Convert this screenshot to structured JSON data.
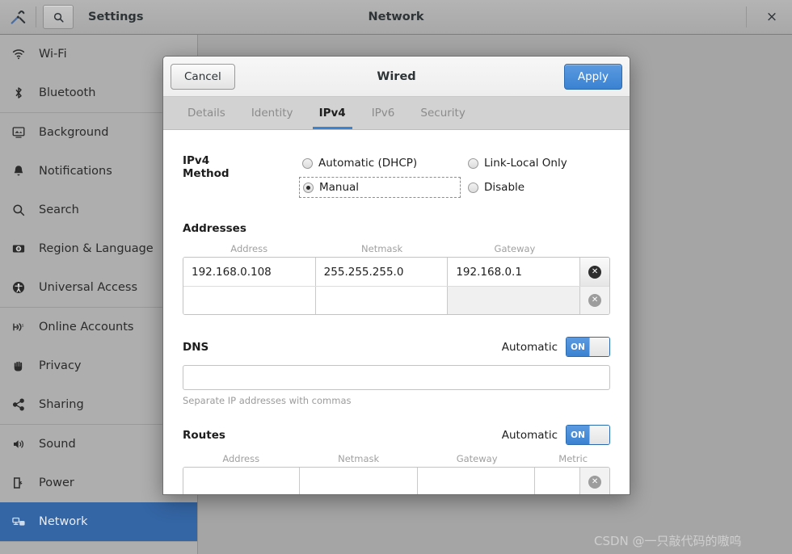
{
  "titlebar": {
    "app_icon": "tools-icon",
    "search_icon": "search-icon",
    "app_label": "Settings",
    "window_title": "Network",
    "close_label": "×"
  },
  "sidebar": {
    "items": [
      {
        "label": "Wi-Fi",
        "icon": "wifi-icon",
        "selected": false
      },
      {
        "label": "Bluetooth",
        "icon": "bluetooth-icon",
        "selected": false
      },
      {
        "label": "Background",
        "icon": "background-icon",
        "selected": false
      },
      {
        "label": "Notifications",
        "icon": "bell-icon",
        "selected": false
      },
      {
        "label": "Search",
        "icon": "search-icon",
        "selected": false
      },
      {
        "label": "Region & Language",
        "icon": "region-icon",
        "selected": false
      },
      {
        "label": "Universal Access",
        "icon": "accessibility-icon",
        "selected": false
      },
      {
        "label": "Online Accounts",
        "icon": "online-accounts-icon",
        "selected": false
      },
      {
        "label": "Privacy",
        "icon": "hand-icon",
        "selected": false
      },
      {
        "label": "Sharing",
        "icon": "share-icon",
        "selected": false
      },
      {
        "label": "Sound",
        "icon": "speaker-icon",
        "selected": false
      },
      {
        "label": "Power",
        "icon": "battery-icon",
        "selected": false
      },
      {
        "label": "Network",
        "icon": "network-icon",
        "selected": true
      }
    ],
    "selected_color": "#3465a4"
  },
  "dialog": {
    "cancel_label": "Cancel",
    "title": "Wired",
    "apply_label": "Apply",
    "accent_color": "#3a82d2",
    "tabs": [
      {
        "label": "Details",
        "active": false
      },
      {
        "label": "Identity",
        "active": false
      },
      {
        "label": "IPv4",
        "active": true
      },
      {
        "label": "IPv6",
        "active": false
      },
      {
        "label": "Security",
        "active": false
      }
    ],
    "ipv4_method": {
      "label": "IPv4 Method",
      "options": [
        {
          "label": "Automatic (DHCP)",
          "selected": false,
          "focused": false
        },
        {
          "label": "Link-Local Only",
          "selected": false,
          "focused": false
        },
        {
          "label": "Manual",
          "selected": true,
          "focused": true
        },
        {
          "label": "Disable",
          "selected": false,
          "focused": false
        }
      ]
    },
    "addresses": {
      "title": "Addresses",
      "columns": [
        "Address",
        "Netmask",
        "Gateway"
      ],
      "rows": [
        {
          "address": "192.168.0.108",
          "netmask": "255.255.255.0",
          "gateway": "192.168.0.1",
          "delete_enabled": true
        },
        {
          "address": "",
          "netmask": "",
          "gateway": "",
          "delete_enabled": false
        }
      ],
      "delete_icon": "remove-circle-icon"
    },
    "dns": {
      "title": "DNS",
      "automatic_label": "Automatic",
      "toggle_state": "ON",
      "value": "",
      "hint": "Separate IP addresses with commas"
    },
    "routes": {
      "title": "Routes",
      "automatic_label": "Automatic",
      "toggle_state": "ON",
      "columns": [
        "Address",
        "Netmask",
        "Gateway",
        "Metric"
      ],
      "rows": [
        {
          "address": "",
          "netmask": "",
          "gateway": "",
          "metric": "",
          "delete_enabled": false
        }
      ]
    }
  },
  "watermark": "CSDN @一只敲代码的嗷呜"
}
